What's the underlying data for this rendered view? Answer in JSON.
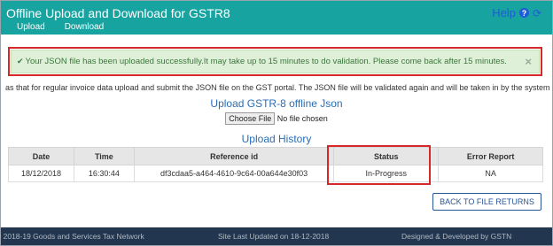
{
  "header": {
    "title": "Offline Upload and Download for GSTR8",
    "help_label": "Help",
    "help_icon": "question-circle-icon",
    "refresh_icon": "refresh-icon",
    "tabs": [
      {
        "label": "Upload",
        "active": true
      },
      {
        "label": "Download",
        "active": false
      }
    ]
  },
  "alert": {
    "check": "✔",
    "message": "Your JSON file has been uploaded successfully.It may take up to 15 minutes to do validation. Please come back after 15 minutes.",
    "close": "×"
  },
  "info_text": "as that for regular invoice data upload and submit the JSON file on the GST portal. The JSON file will be validated again and will be taken in by the system i",
  "upload": {
    "title": "Upload GSTR-8 offline Json",
    "choose_label": "Choose File",
    "file_status": "No file chosen"
  },
  "history": {
    "title": "Upload History",
    "columns": [
      "Date",
      "Time",
      "Reference id",
      "Status",
      "Error Report"
    ],
    "rows": [
      {
        "date": "18/12/2018",
        "time": "16:30:44",
        "reference_id": "df3cdaa5-a464-4610-9c64-00a644e30f03",
        "status": "In-Progress",
        "error_report": "NA"
      }
    ]
  },
  "back_button": "BACK TO FILE RETURNS",
  "footer": {
    "copyright": "© 2018-19 Goods and Services Tax Network",
    "updated": "Site Last Updated on 18-12-2018",
    "designed": "Designed & Developed by GSTN"
  },
  "colors": {
    "header_bg": "#17a3a0",
    "alert_bg": "#dff0d8",
    "alert_text": "#3c763d",
    "highlight_border": "#d62828",
    "footer_bg": "#22374f",
    "link_blue": "#2a6db5"
  }
}
